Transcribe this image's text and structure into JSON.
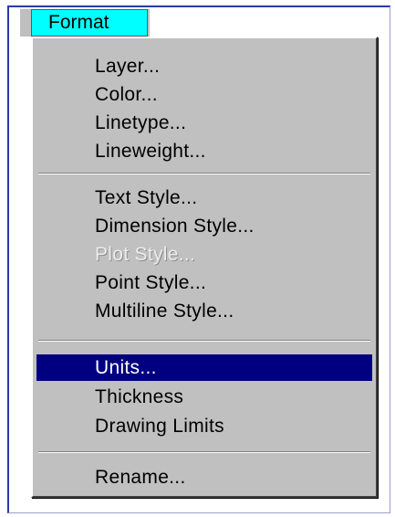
{
  "menubar": {
    "title": "Format"
  },
  "menu": {
    "groups": [
      [
        "Layer...",
        "Color...",
        "Linetype...",
        "Lineweight..."
      ],
      [
        "Text Style...",
        "Dimension Style...",
        "Plot Style...",
        "Point Style...",
        "Multiline Style..."
      ],
      [
        "Units...",
        "Thickness",
        "Drawing Limits"
      ],
      [
        "Rename..."
      ]
    ],
    "selected": "Units...",
    "disabled": [
      "Plot Style..."
    ]
  },
  "colors": {
    "title_bg": "#00ffff",
    "menu_bg": "#c0c0c0",
    "highlight": "#000080",
    "frame_border": "#2b3aa8"
  }
}
